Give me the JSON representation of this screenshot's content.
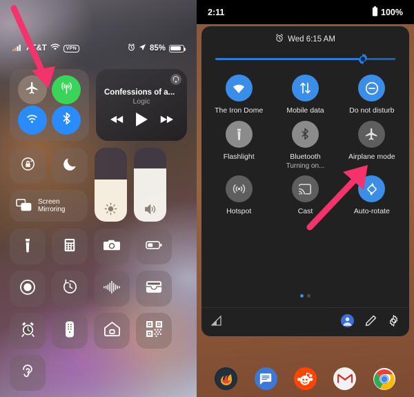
{
  "ios": {
    "status_bar": {
      "carrier": "AT&T",
      "vpn_label": "VPN",
      "battery_percent": "85%",
      "alarm_icon": "alarm-icon",
      "location_icon": "location-arrow-icon",
      "wifi_icon": "wifi-icon",
      "signal_icon": "cellular-signal-icon"
    },
    "connectivity": {
      "airplane": {
        "label": "Airplane Mode",
        "state": "off",
        "icon": "airplane-icon"
      },
      "cellular": {
        "label": "Cellular Data",
        "state": "on",
        "icon": "cellular-tower-icon",
        "color": "#3ad45a"
      },
      "wifi": {
        "label": "Wi-Fi",
        "state": "on",
        "icon": "wifi-icon",
        "color": "#2a8cfb"
      },
      "bluetooth": {
        "label": "Bluetooth",
        "state": "on",
        "icon": "bluetooth-icon",
        "color": "#2a8cfb"
      }
    },
    "now_playing": {
      "title": "Confessions of a...",
      "artist": "Logic",
      "airplay_icon": "airplay-icon",
      "rewind_icon": "rewind-icon",
      "play_icon": "play-icon",
      "forward_icon": "fast-forward-icon"
    },
    "controls": {
      "orientation_lock": {
        "label": "Orientation Lock",
        "icon": "rotation-lock-icon"
      },
      "do_not_disturb": {
        "label": "Do Not Disturb",
        "icon": "moon-icon"
      },
      "screen_mirroring": {
        "label": "Screen\nMirroring",
        "line1": "Screen",
        "line2": "Mirroring",
        "icon": "screen-mirroring-icon"
      },
      "brightness": {
        "label": "Brightness",
        "value": 57,
        "icon": "brightness-icon"
      },
      "volume": {
        "label": "Volume",
        "value": 72,
        "icon": "volume-icon"
      }
    },
    "shortcuts": [
      {
        "label": "Flashlight",
        "icon": "flashlight-icon"
      },
      {
        "label": "Calculator",
        "icon": "calculator-icon"
      },
      {
        "label": "Camera",
        "icon": "camera-icon"
      },
      {
        "label": "Low Power Mode",
        "icon": "battery-icon"
      },
      {
        "label": "Screen Recording",
        "icon": "screen-record-icon"
      },
      {
        "label": "Timer",
        "icon": "timer-icon"
      },
      {
        "label": "Sound Recognition",
        "icon": "sound-recognition-icon"
      },
      {
        "label": "Wallet",
        "icon": "wallet-icon"
      },
      {
        "label": "Alarm",
        "icon": "alarm-clock-icon"
      },
      {
        "label": "Remote",
        "icon": "apple-tv-remote-icon"
      },
      {
        "label": "Home",
        "icon": "home-icon"
      },
      {
        "label": "QR Code Scanner",
        "icon": "qr-code-icon"
      },
      {
        "label": "Hearing",
        "icon": "ear-icon"
      }
    ],
    "annotation": {
      "arrow": "red-arrow-pointing-to-airplane-mode",
      "color": "#f4326b"
    }
  },
  "android": {
    "status_bar": {
      "time": "2:11",
      "battery_percent": "100%",
      "battery_icon": "battery-full-icon"
    },
    "header": {
      "alarm_icon": "alarm-icon",
      "alarm_text": "Wed 6:15 AM"
    },
    "brightness": {
      "label": "Brightness",
      "value": 82,
      "icon": "brightness-slider-icon",
      "color": "#2a7ddb"
    },
    "tiles": [
      {
        "label": "The Iron Dome",
        "sub": "",
        "state": "on",
        "icon": "wifi-icon"
      },
      {
        "label": "Mobile data",
        "sub": "",
        "state": "on",
        "icon": "mobile-data-icon"
      },
      {
        "label": "Do not disturb",
        "sub": "",
        "state": "on",
        "icon": "do-not-disturb-icon"
      },
      {
        "label": "Flashlight",
        "sub": "",
        "state": "off",
        "icon": "flashlight-icon"
      },
      {
        "label": "Bluetooth",
        "sub": "Turning on...",
        "state": "off",
        "icon": "bluetooth-icon"
      },
      {
        "label": "Airplane mode",
        "sub": "",
        "state": "dim",
        "icon": "airplane-icon"
      },
      {
        "label": "Hotspot",
        "sub": "",
        "state": "dim",
        "icon": "hotspot-icon"
      },
      {
        "label": "Cast",
        "sub": "",
        "state": "dim",
        "icon": "cast-icon"
      },
      {
        "label": "Auto-rotate",
        "sub": "",
        "state": "on",
        "icon": "auto-rotate-icon"
      }
    ],
    "pagination": {
      "pages": 2,
      "active": 1
    },
    "footer": {
      "signal_icon": "signal-strength-icon",
      "user_icon": "user-account-icon",
      "edit_icon": "pencil-edit-icon",
      "settings_icon": "settings-gear-icon"
    },
    "dock": [
      {
        "label": "Firefox",
        "icon": "firefox-icon"
      },
      {
        "label": "Messages",
        "icon": "messages-icon"
      },
      {
        "label": "Reddit",
        "icon": "reddit-icon"
      },
      {
        "label": "Gmail",
        "icon": "gmail-icon"
      },
      {
        "label": "Chrome",
        "icon": "chrome-icon"
      }
    ],
    "annotation": {
      "arrow": "red-arrow-pointing-to-airplane-mode-tile",
      "color": "#f4326b"
    }
  }
}
